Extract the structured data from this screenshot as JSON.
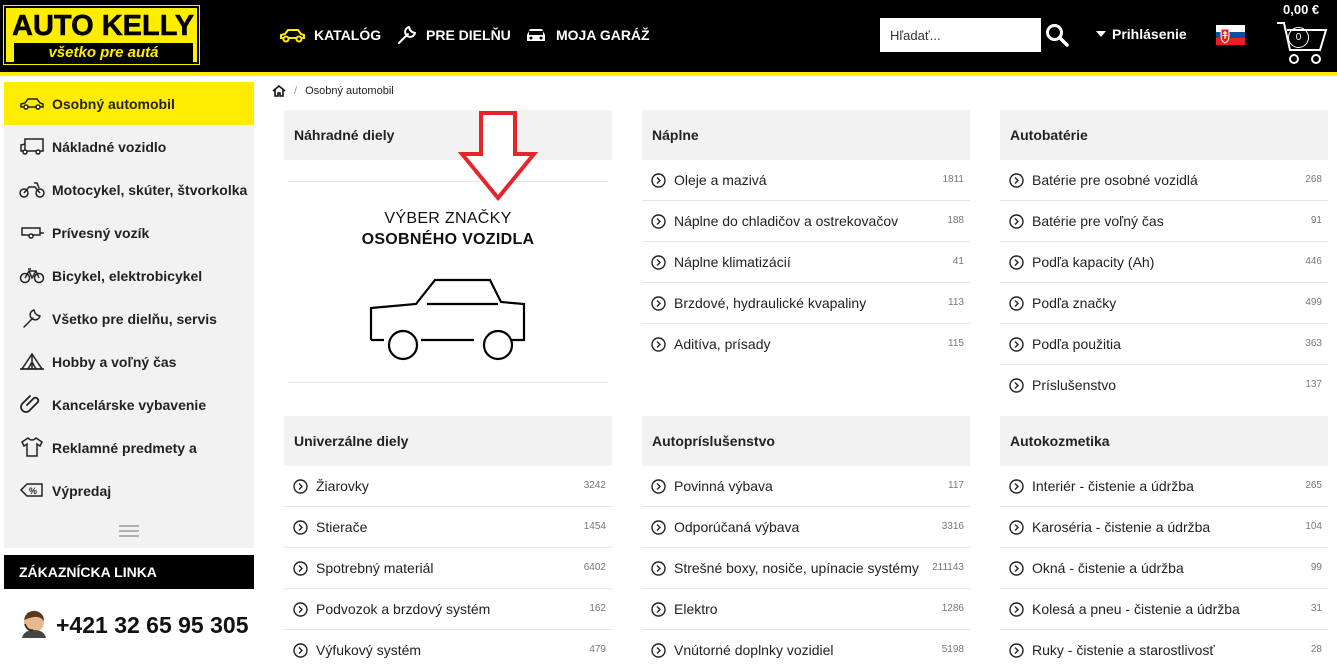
{
  "header": {
    "logo_main": "AUTO KELLY",
    "logo_sub": "všetko pre autá",
    "nav": [
      {
        "label": "KATALÓG",
        "icon": "car-icon"
      },
      {
        "label": "PRE DIELŇU",
        "icon": "wrench-icon"
      },
      {
        "label": "MOJA GARÁŽ",
        "icon": "garage-car-icon"
      }
    ],
    "search_placeholder": "Hľadať...",
    "login_label": "Prihlásenie",
    "cart_price": "0,00 €",
    "cart_count": "0",
    "colors": {
      "brand_yellow": "#ffed00",
      "header_bg": "#000000"
    }
  },
  "sidebar": {
    "items": [
      {
        "label": "Osobný automobil",
        "icon": "car-icon",
        "active": true
      },
      {
        "label": "Nákladné vozidlo",
        "icon": "truck-icon"
      },
      {
        "label": "Motocykel, skúter, štvorkolka",
        "icon": "motorcycle-icon"
      },
      {
        "label": "Prívesný vozík",
        "icon": "trailer-icon"
      },
      {
        "label": "Bicykel, elektrobicykel",
        "icon": "bicycle-icon"
      },
      {
        "label": "Všetko pre dielňu, servis",
        "icon": "wrench-icon"
      },
      {
        "label": "Hobby a voľný čas",
        "icon": "tent-icon"
      },
      {
        "label": "Kancelárske vybavenie",
        "icon": "paperclip-icon"
      },
      {
        "label": "Reklamné predmety a",
        "icon": "tshirt-icon"
      },
      {
        "label": "Výpredaj",
        "icon": "discount-tag-icon"
      }
    ],
    "hotline_title": "ZÁKAZNÍCKA LINKA",
    "hotline_phone": "+421 32 65 95 305"
  },
  "breadcrumb": {
    "current": "Osobný automobil"
  },
  "brand_select": {
    "line1": "VÝBER ZNAČKY",
    "line2": "OSOBNÉHO VOZIDLA"
  },
  "categories": [
    {
      "title": "Náhradné diely",
      "items": []
    },
    {
      "title": "Náplne",
      "items": [
        {
          "name": "Oleje a mazivá",
          "count": "1811"
        },
        {
          "name": "Náplne do chladičov a ostrekovačov",
          "count": "188"
        },
        {
          "name": "Náplne klimatizácií",
          "count": "41"
        },
        {
          "name": "Brzdové, hydraulické kvapaliny",
          "count": "113"
        },
        {
          "name": "Aditíva, prísady",
          "count": "115"
        }
      ]
    },
    {
      "title": "Autobatérie",
      "items": [
        {
          "name": "Batérie pre osobné vozidlá",
          "count": "268"
        },
        {
          "name": "Batérie pre voľný čas",
          "count": "91"
        },
        {
          "name": "Podľa kapacity (Ah)",
          "count": "446"
        },
        {
          "name": "Podľa značky",
          "count": "499"
        },
        {
          "name": "Podľa použitia",
          "count": "363"
        },
        {
          "name": "Príslušenstvo",
          "count": "137"
        }
      ]
    },
    {
      "title": "Univerzálne diely",
      "items": [
        {
          "name": "Žiarovky",
          "count": "3242"
        },
        {
          "name": "Stierače",
          "count": "1454"
        },
        {
          "name": "Spotrebný materiál",
          "count": "6402"
        },
        {
          "name": "Podvozok a brzdový systém",
          "count": "162"
        },
        {
          "name": "Výfukový systém",
          "count": "479"
        }
      ]
    },
    {
      "title": "Autopríslušenstvo",
      "items": [
        {
          "name": "Povinná výbava",
          "count": "117"
        },
        {
          "name": "Odporúčaná výbava",
          "count": "3316"
        },
        {
          "name": "Strešné boxy, nosiče, upínacie systémy",
          "count": "211143"
        },
        {
          "name": "Elektro",
          "count": "1286"
        },
        {
          "name": "Vnútorné doplnky vozidiel",
          "count": "5198"
        }
      ]
    },
    {
      "title": "Autokozmetika",
      "items": [
        {
          "name": "Interiér - čistenie a údržba",
          "count": "265"
        },
        {
          "name": "Karoséria - čistenie a údržba",
          "count": "104"
        },
        {
          "name": "Okná - čistenie a údržba",
          "count": "99"
        },
        {
          "name": "Kolesá a pneu - čistenie a údržba",
          "count": "31"
        },
        {
          "name": "Ruky - čistenie a starostlivosť",
          "count": "28"
        }
      ]
    }
  ]
}
